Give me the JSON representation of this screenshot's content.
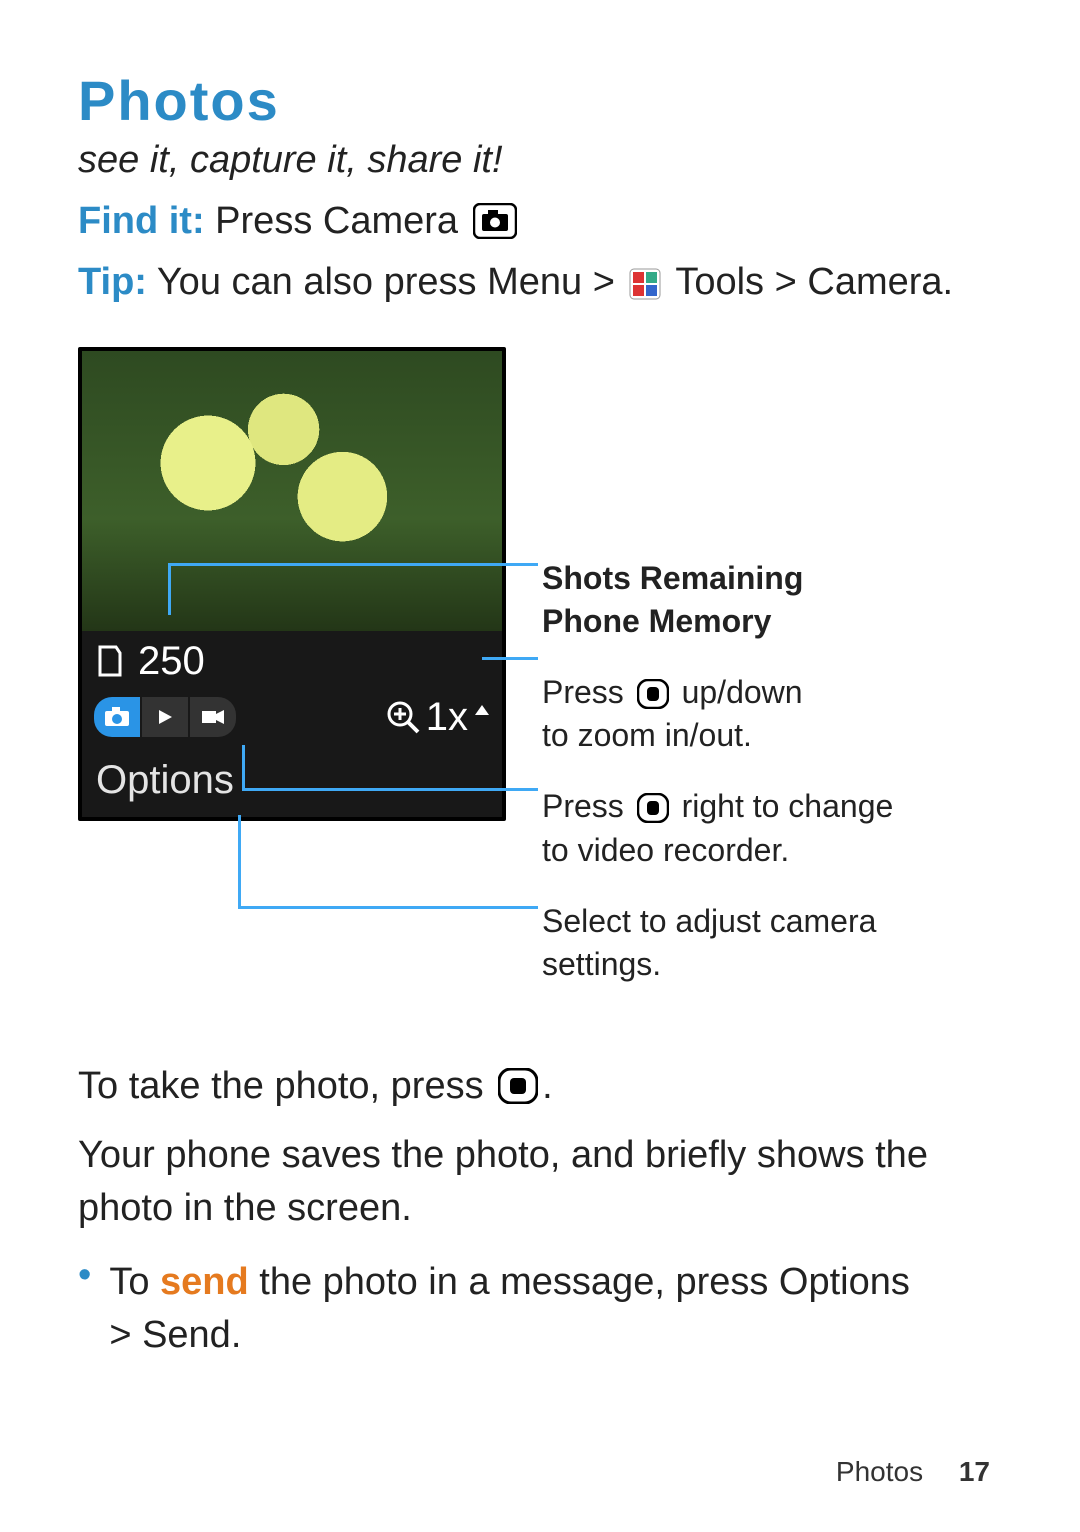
{
  "title": "Photos",
  "tagline": "see it, capture it, share it!",
  "findit_label": "Find it:",
  "findit_rest_1": " Press Camera ",
  "tip_label": "Tip:",
  "tip_before": " You can also press ",
  "tip_menu": "Menu",
  "tip_middle": " > ",
  "tip_tools": " Tools",
  "tip_camera": "Camera",
  "tip_period": ".",
  "phone": {
    "shots_remaining": "250",
    "zoom_text": "1x",
    "options_label": "Options"
  },
  "callouts": {
    "shots_l1": "Shots Remaining",
    "shots_l2": "Phone Memory",
    "zoom_before": "Press ",
    "zoom_after1": " up/down",
    "zoom_after2": "to zoom in/out.",
    "mode_before": "Press ",
    "mode_after1": " right to change",
    "mode_after2": "to video recorder.",
    "opt_l1": "Select to adjust camera",
    "opt_l2": "settings."
  },
  "body": {
    "take_before": "To take the photo, press ",
    "take_after": ".",
    "saves": "Your phone saves the photo, and briefly shows the photo in the screen.",
    "bullet_before": "To ",
    "bullet_send": "send",
    "bullet_mid": " the photo in a message, press ",
    "bullet_options": "Options",
    "bullet_gt": "> ",
    "bullet_send2": "Send",
    "bullet_period": "."
  },
  "footer": {
    "section": "Photos",
    "page": "17"
  }
}
